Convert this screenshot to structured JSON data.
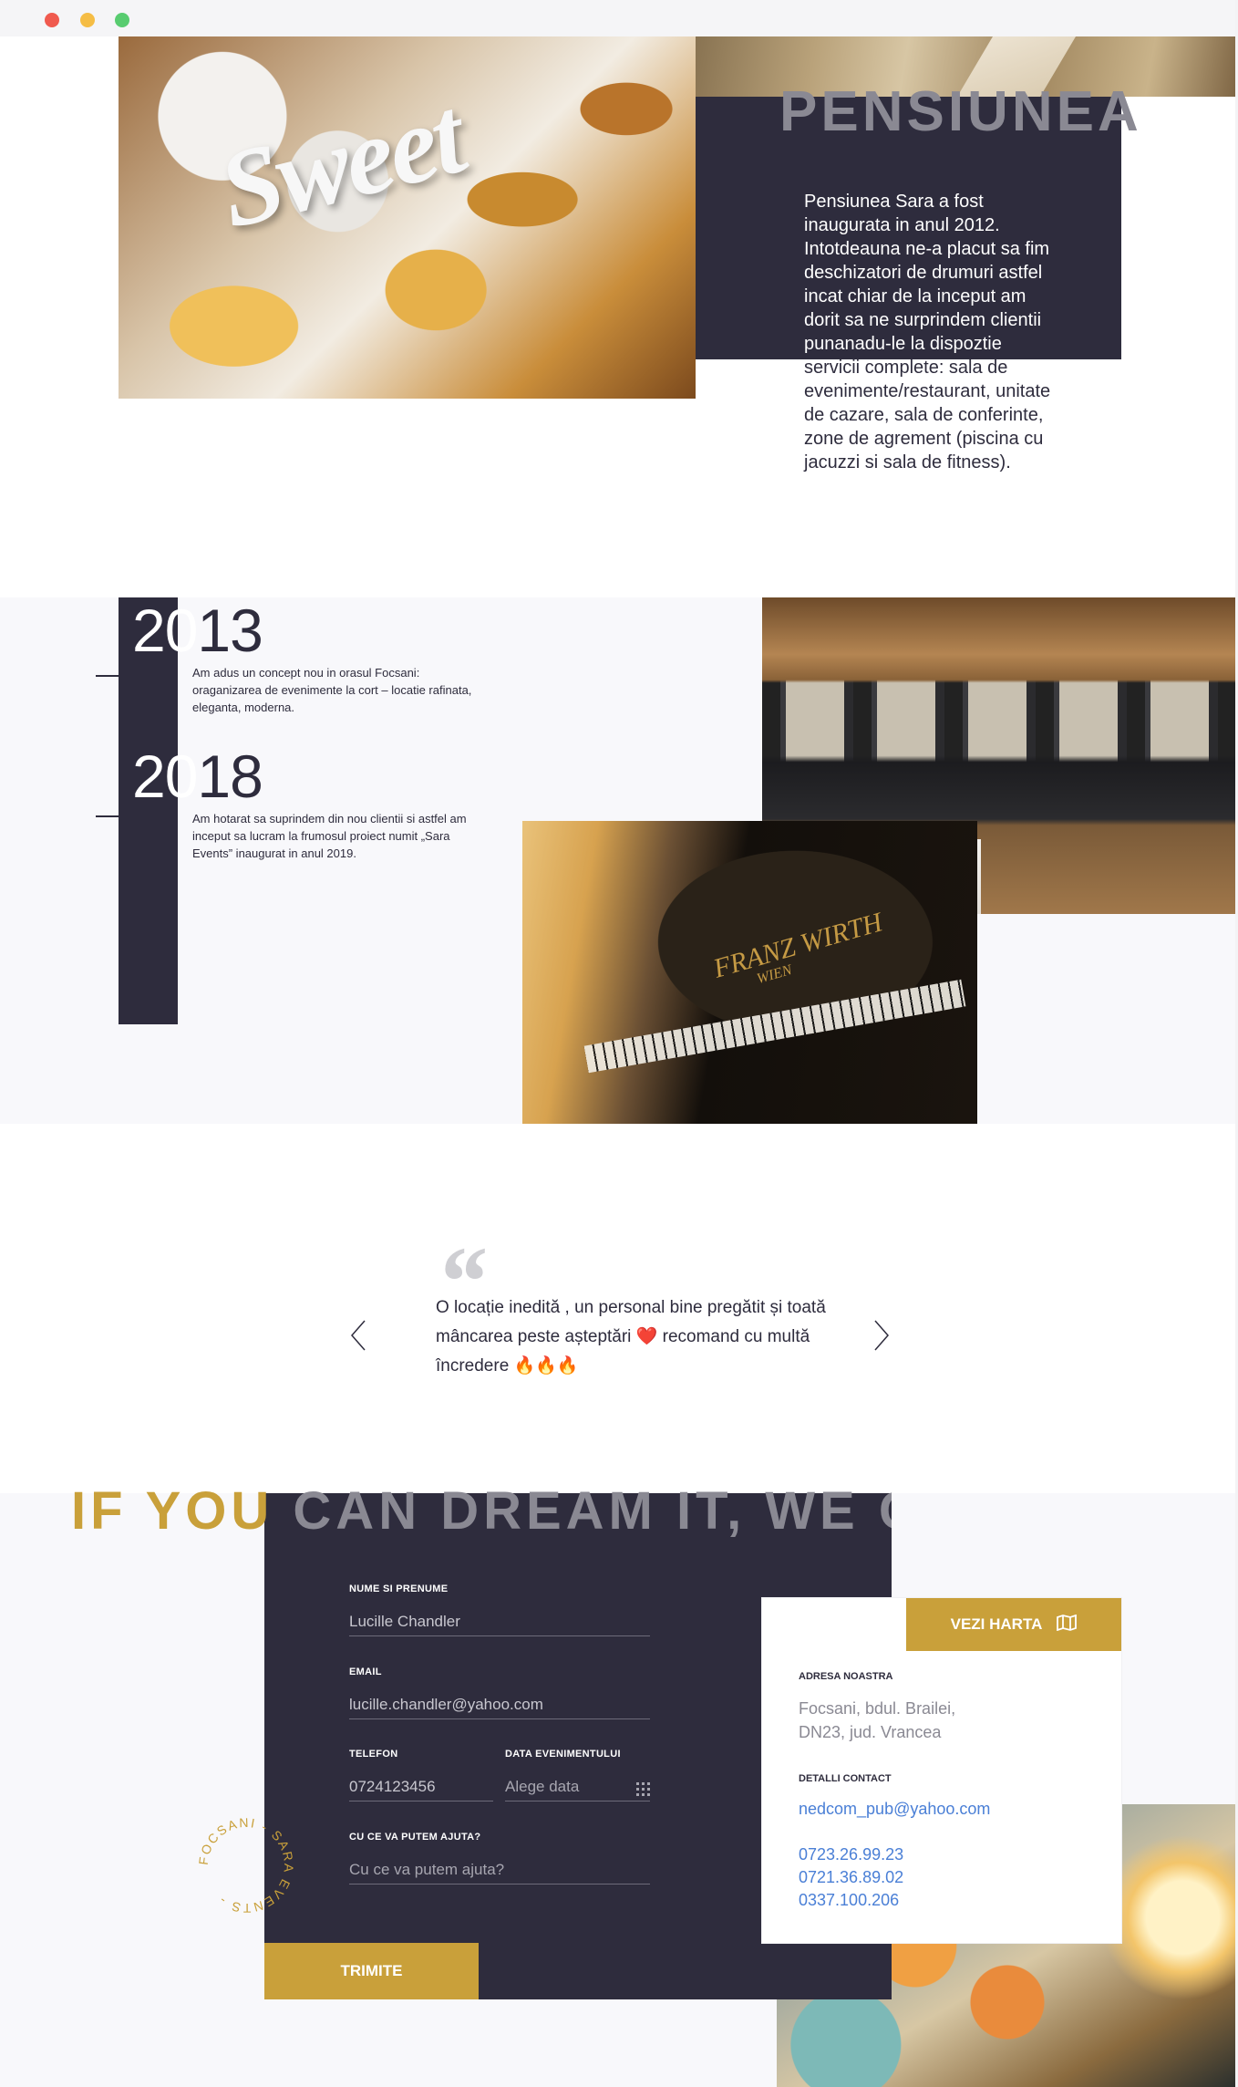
{
  "about": {
    "title": "PENSIUNEA",
    "text": "Pensiunea Sara a fost inaugurata in anul 2012. Intotdeauna ne-a placut sa fim deschizatori de drumuri astfel incat chiar de la inceput am dorit sa ne surprindem clientii punanadu-le la dispoztie servicii complete: sala de evenimente/restaurant, unitate de cazare, sala de conferinte, zone de agrement (piscina cu jacuzzi si sala de fitness).",
    "image_word": "Sweet"
  },
  "timeline": {
    "items": [
      {
        "year_a": "20",
        "year_b": "13",
        "text": "Am adus un concept nou in orasul Focsani: oraganizarea de evenimente la cort – locatie rafinata, eleganta, moderna."
      },
      {
        "year_a": "20",
        "year_b": "18",
        "text": "Am hotarat sa suprindem din nou clientii si astfel am inceput sa lucram la frumosul proiect numit „Sara Events” inaugurat in anul 2019."
      }
    ],
    "piano_brand": "FRANZ WIRTH",
    "piano_sub": "WIEN"
  },
  "testimonial": {
    "quote_mark": "“",
    "text": "O locație inedită , un personal bine pregătit și toată mâncarea peste așteptări ❤️ recomand cu multă încredere 🔥🔥🔥",
    "prev_icon": "chevron-left-icon",
    "next_icon": "chevron-right-icon"
  },
  "contact": {
    "banner_gold": "IF YOU ",
    "banner_grey": "CAN DREAM IT, WE C",
    "form": {
      "name_label": "NUME SI PRENUME",
      "name_value": "Lucille Chandler",
      "email_label": "EMAIL",
      "email_value": "lucille.chandler@yahoo.com",
      "phone_label": "TELEFON",
      "phone_value": "0724123456",
      "date_label": "DATA EVENIMENTULUI",
      "date_placeholder": "Alege data",
      "help_label": "CU CE VA PUTEM AJUTA?",
      "help_placeholder": "Cu ce va putem ajuta?",
      "submit": "TRIMITE"
    },
    "circle_text": "FOCSANI - SARA EVENTS -",
    "map_button": "VEZI HARTA",
    "map_icon": "map-icon",
    "address_label": "ADRESA NOASTRA",
    "address_line1": "Focsani, bdul. Brailei,",
    "address_line2": "DN23, jud. Vrancea",
    "details_label": "DETALLI CONTACT",
    "email": "nedcom_pub@yahoo.com",
    "phones": [
      "0723.26.99.23",
      "0721.36.89.02",
      "0337.100.206"
    ]
  },
  "colors": {
    "dark": "#2e2c3d",
    "gold": "#c9a03a",
    "grey_title": "#8a8993",
    "link": "#4a7fd6"
  }
}
